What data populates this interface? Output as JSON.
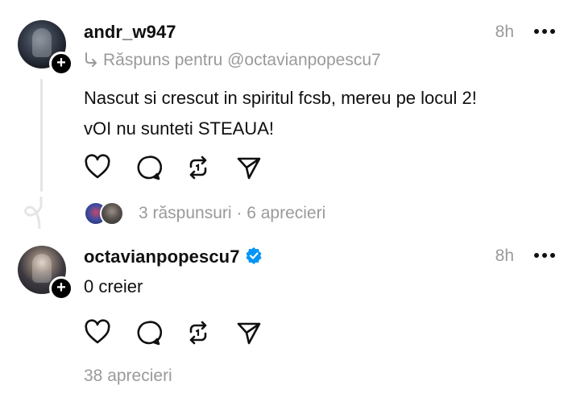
{
  "post1": {
    "username": "andr_w947",
    "time": "8h",
    "reply_to": "Răspuns pentru @octavianpopescu7",
    "text_line1": "Nascut si crescut in spiritul fcsb, mereu pe locul 2!",
    "text_line2": "vOI nu sunteti STEAUA!",
    "stats": "3 răspunsuri · 6 aprecieri",
    "avatar_icon": "avatar",
    "follow_icon": "plus-icon"
  },
  "post2": {
    "username": "octavianpopescu7",
    "verified": true,
    "time": "8h",
    "text": "0 creier",
    "stats": "38 aprecieri"
  },
  "colors": {
    "text": "#101010",
    "muted": "#9a9a9a",
    "verified": "#0095f6",
    "thread_line": "#e5e5e5"
  },
  "actions": [
    "heart-icon",
    "comment-icon",
    "repost-icon",
    "share-icon"
  ]
}
